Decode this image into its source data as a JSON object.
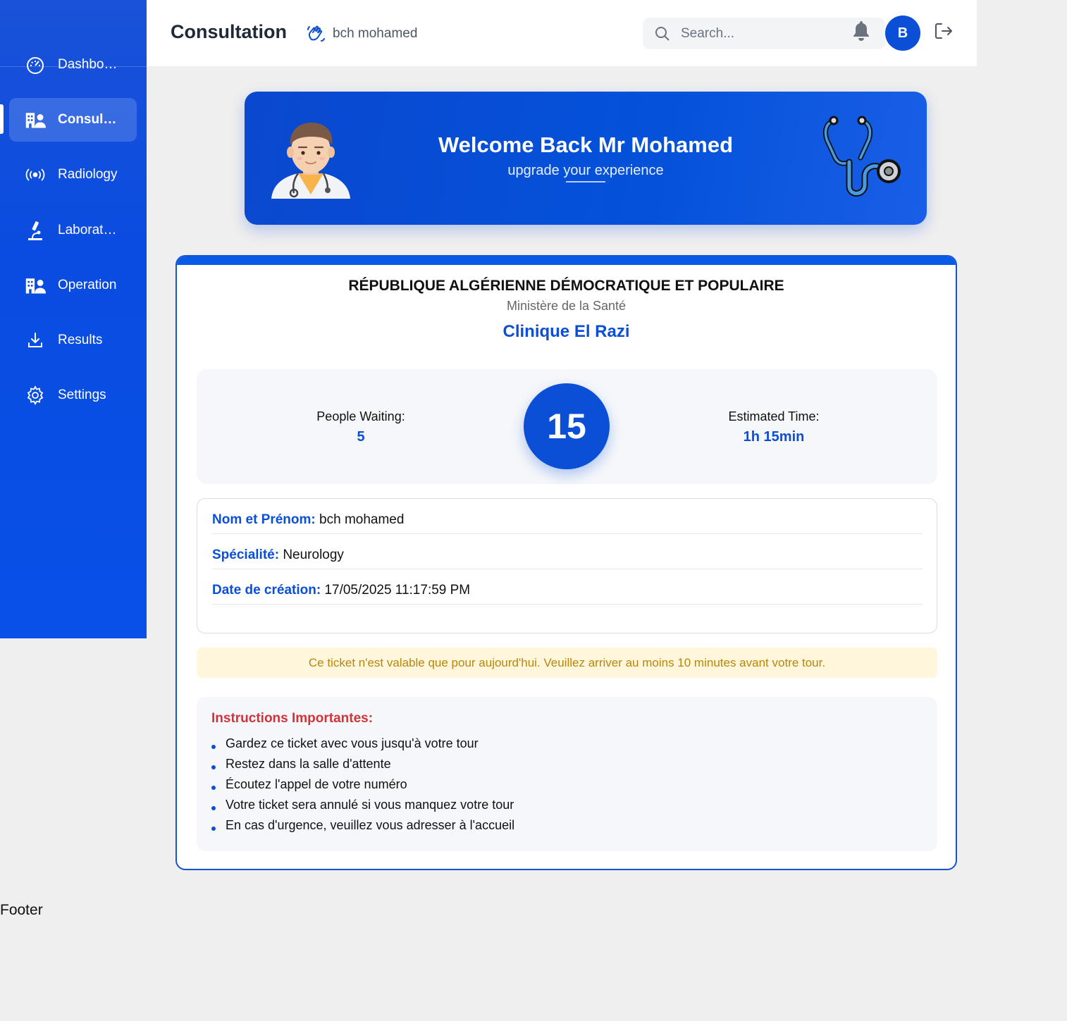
{
  "sidebar": {
    "items": [
      {
        "label": "Dashbo…",
        "icon": "dashboard-icon"
      },
      {
        "label": "Consul…",
        "icon": "hospital-user-icon",
        "active": true
      },
      {
        "label": "Radiology",
        "icon": "radio-waves-icon"
      },
      {
        "label": "Laborat…",
        "icon": "microscope-icon"
      },
      {
        "label": "Operation",
        "icon": "hospital-user-icon"
      },
      {
        "label": "Results",
        "icon": "download-icon"
      },
      {
        "label": "Settings",
        "icon": "gear-icon"
      }
    ]
  },
  "header": {
    "title": "Consultation",
    "user_name": "bch mohamed",
    "search_placeholder": "Search...",
    "avatar_initial": "B"
  },
  "banner": {
    "title": "Welcome Back Mr Mohamed",
    "subtitle": "upgrade your experience"
  },
  "ticket": {
    "country": "RÉPUBLIQUE ALGÉRIENNE DÉMOCRATIQUE ET POPULAIRE",
    "ministry": "Ministère de la Santé",
    "clinic": "Clinique El Razi",
    "queue": {
      "waiting_label": "People Waiting:",
      "waiting_value": "5",
      "number": "15",
      "time_label": "Estimated Time:",
      "time_value": "1h 15min"
    },
    "info": [
      {
        "key": "Nom et Prénom:",
        "value": "bch mohamed"
      },
      {
        "key": "Spécialité:",
        "value": "Neurology"
      },
      {
        "key": "Date de création:",
        "value": "17/05/2025 11:17:59 PM"
      }
    ],
    "notice": "Ce ticket n'est valable que pour aujourd'hui. Veuillez arriver au moins 10 minutes avant votre tour.",
    "instructions_title": "Instructions Importantes:",
    "instructions": [
      "Gardez ce ticket avec vous jusqu'à votre tour",
      "Restez dans la salle d'attente",
      "Écoutez l'appel de votre numéro",
      "Votre ticket sera annulé si vous manquez votre tour",
      "En cas d'urgence, veuillez vous adresser à l'accueil"
    ]
  },
  "footer": {
    "text": "Footer"
  },
  "colors": {
    "primary": "#0a4fd6",
    "warning_text": "#b8860b",
    "danger_text": "#d0343a"
  }
}
